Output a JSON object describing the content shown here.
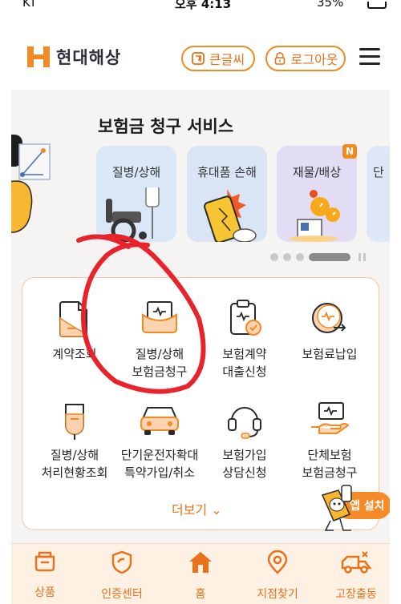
{
  "status_bar": {
    "carrier": "KT",
    "time": "오후 4:13",
    "battery": "35%"
  },
  "header": {
    "brand": "현대해상",
    "big_text_button": "큰글씨",
    "logout_button": "로그아웃"
  },
  "claim_service": {
    "title": "보험금 청구 서비스",
    "cards": [
      {
        "label": "질병/상해",
        "icon": "wheelchair-icon"
      },
      {
        "label": "휴대품 손해",
        "icon": "broken-phone-icon"
      },
      {
        "label": "재물/배상",
        "icon": "water-leak-icon",
        "badge": "N"
      },
      {
        "label": "단",
        "icon": ""
      }
    ]
  },
  "menu": {
    "items": [
      {
        "label_line1": "계약조회",
        "label_line2": "",
        "icon": "document-icon"
      },
      {
        "label_line1": "질병/상해",
        "label_line2": "보험금청구",
        "icon": "money-envelope-icon"
      },
      {
        "label_line1": "보험계약",
        "label_line2": "대출신청",
        "icon": "clipboard-money-icon"
      },
      {
        "label_line1": "보험료납입",
        "label_line2": "",
        "icon": "coin-arrow-icon"
      },
      {
        "label_line1": "질병/상해",
        "label_line2": "처리현황조회",
        "icon": "iv-bag-icon"
      },
      {
        "label_line1": "단기운전자확대",
        "label_line2": "특약가입/취소",
        "icon": "car-icon"
      },
      {
        "label_line1": "보험가입",
        "label_line2": "상담신청",
        "icon": "headset-icon"
      },
      {
        "label_line1": "단체보험",
        "label_line2": "보험금청구",
        "icon": "hand-money-icon"
      }
    ],
    "more": "더보기"
  },
  "fab": {
    "label": "앱 설치"
  },
  "bottom_nav": [
    {
      "label": "상품",
      "icon": "product-box-icon"
    },
    {
      "label": "인증센터",
      "icon": "shield-icon"
    },
    {
      "label": "홈",
      "icon": "home-icon"
    },
    {
      "label": "지점찾기",
      "icon": "location-pin-icon"
    },
    {
      "label": "고장출동",
      "icon": "tow-truck-icon"
    }
  ],
  "colors": {
    "accent": "#f08a24",
    "accent_text": "#e8711a",
    "annotation": "#e8232b"
  }
}
